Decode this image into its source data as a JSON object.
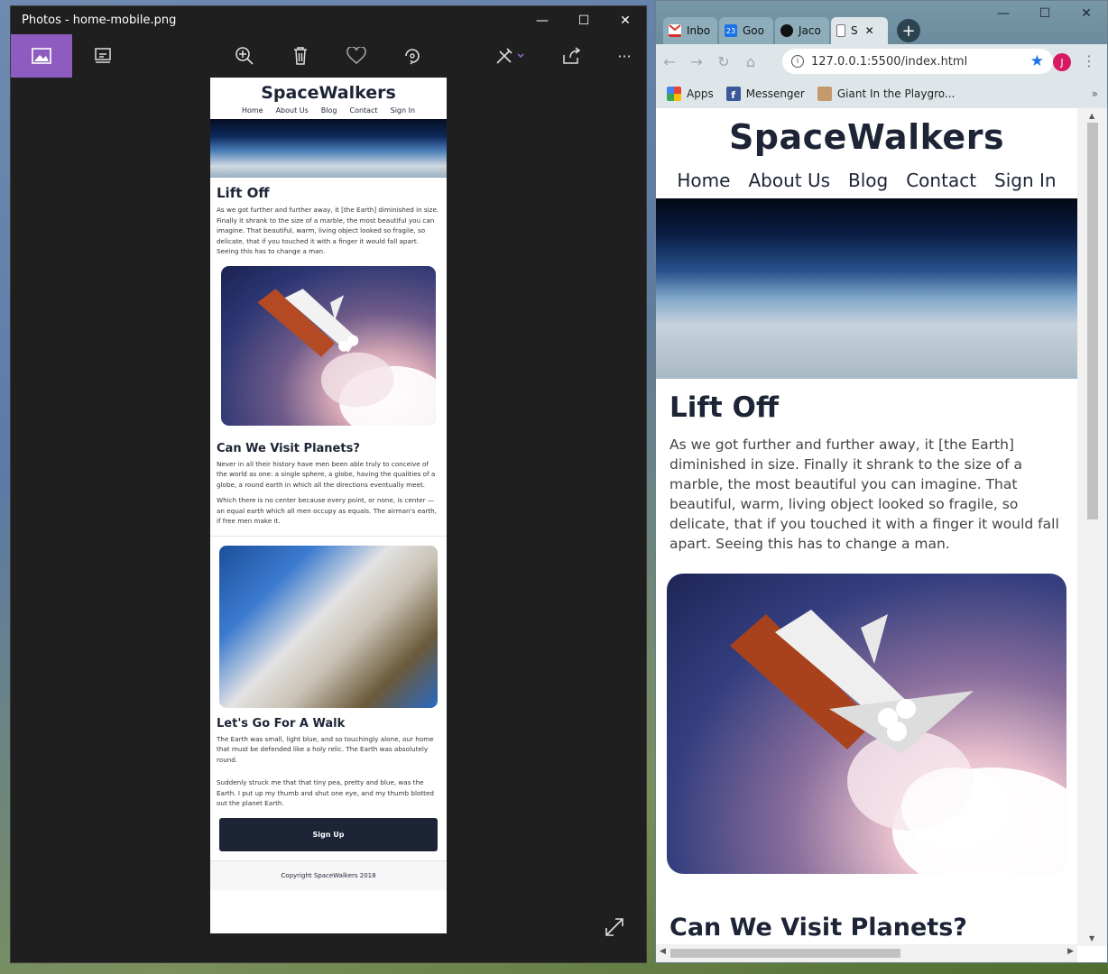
{
  "photos": {
    "title": "Photos - home-mobile.png",
    "controls": {
      "minimize": "—",
      "maximize": "☐",
      "close": "✕"
    },
    "toolbar": [
      "picture-icon",
      "slideshow-icon",
      "zoom-in-icon",
      "delete-icon",
      "heart-icon",
      "rotate-icon",
      "edit-icon",
      "share-icon",
      "more-icon"
    ],
    "more_label": "···",
    "mobile": {
      "brand": "SpaceWalkers",
      "nav": [
        "Home",
        "About Us",
        "Blog",
        "Contact",
        "Sign In"
      ],
      "h_liftoff": "Lift Off",
      "p_liftoff": "As we got further and further away, it [the Earth] diminished in size. Finally it shrank to the size of a marble, the most beautiful you can imagine. That beautiful, warm, living object looked so fragile, so delicate, that if you touched it with a finger it would fall apart. Seeing this has to change a man.",
      "h_planets": "Can We Visit Planets?",
      "p_planets_1": "Never in all their history have men been able truly to conceive of the world as one: a single sphere, a globe, having the qualities of a globe, a round earth in which all the directions eventually meet.",
      "p_planets_2": "Which there is no center because every point, or none, is center — an equal earth which all men occupy as equals. The airman's earth, if free men make it.",
      "h_walk": "Let's Go For A Walk",
      "p_walk_1": "The Earth was small, light blue, and so touchingly alone, our home that must be defended like a holy relic. The Earth was absolutely round.",
      "p_walk_2": "Suddenly struck me that that tiny pea, pretty and blue, was the Earth. I put up my thumb and shut one eye, and my thumb blotted out the planet Earth.",
      "signup": "Sign Up",
      "footer": "Copyright SpaceWalkers 2018"
    }
  },
  "chrome": {
    "tabs": [
      {
        "label": "Inbo",
        "icon": "gmail-icon"
      },
      {
        "label": "Goo",
        "icon": "calendar-icon"
      },
      {
        "label": "Jaco",
        "icon": "github-icon"
      },
      {
        "label": "S",
        "icon": "page-icon"
      }
    ],
    "calendar_day": "23",
    "new_tab": "+",
    "url": "127.0.0.1:5500/index.html",
    "profile_initial": "J",
    "bookmarks": [
      {
        "label": "Apps",
        "icon": "apps-icon"
      },
      {
        "label": "Messenger",
        "icon": "facebook-icon"
      },
      {
        "label": "Giant In the Playgro...",
        "icon": "bookmark-icon"
      }
    ],
    "bookmarks_overflow": "»",
    "page": {
      "brand": "SpaceWalkers",
      "nav": [
        "Home",
        "About Us",
        "Blog",
        "Contact",
        "Sign In"
      ],
      "h_liftoff": "Lift Off",
      "p_liftoff": "As we got further and further away, it [the Earth] diminished in size. Finally it shrank to the size of a marble, the most beautiful you can imagine. That beautiful, warm, living object looked so fragile, so delicate, that if you touched it with a finger it would fall apart. Seeing this has to change a man.",
      "h_planets": "Can We Visit Planets?"
    }
  }
}
